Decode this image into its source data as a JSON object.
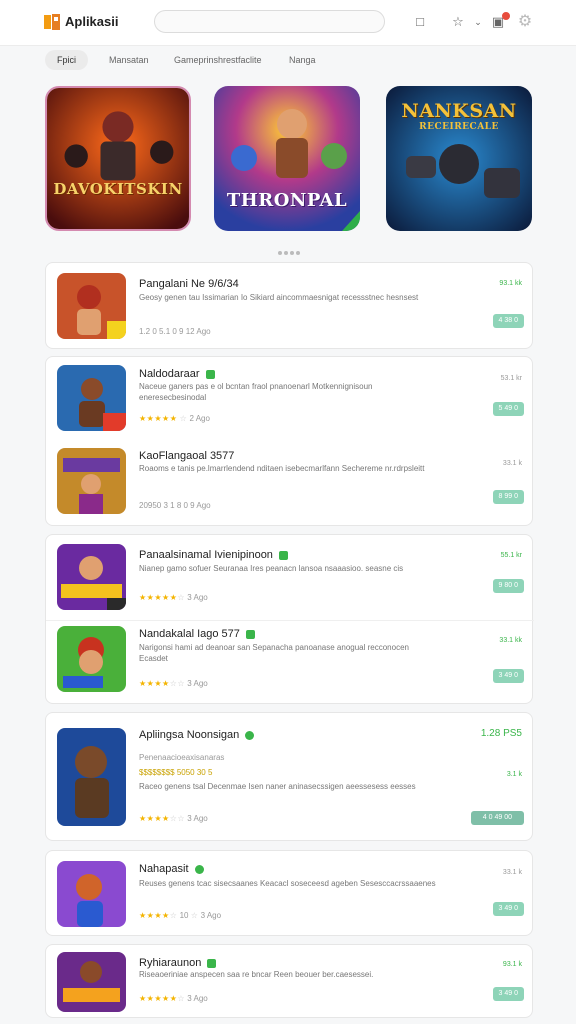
{
  "header": {
    "app_name": "Aplikasii",
    "search_placeholder": "",
    "icons": [
      "download-icon",
      "star-icon",
      "chevron-down-icon",
      "bag-icon",
      "settings-icon"
    ]
  },
  "tabs": [
    {
      "label": "Fpici",
      "active": true
    },
    {
      "label": "Mansatan",
      "active": false
    },
    {
      "label": "Gameprinshrestfaclite",
      "active": false
    },
    {
      "label": "Nanga",
      "active": false
    }
  ],
  "banners": [
    {
      "title": "DAVOKITSKIN"
    },
    {
      "title": "THRONPAL"
    },
    {
      "title": "NANKSAN",
      "subtitle": "RECEIRECALE"
    }
  ],
  "apps": [
    {
      "title": "Pangalani Ne 9/6/34",
      "desc": "Geosy genen tau Issimarian Io Sikiard aincommaesnigat recessstnec hesnsest",
      "meta": "1.2 0 5.1 0 9 12 Ago",
      "size": "93.1 kk",
      "download": "4 38 0"
    },
    {
      "title": "Naldodaraar",
      "desc": "Naceue ganers pas e ol bcntan fraol pnanoenarl Motkennignisoun eneresecbesinodal",
      "meta": "★★★★★ 2 Ago",
      "size": "53.1 kr",
      "download": "5 49 0"
    },
    {
      "title": "KaoFlangaoal 3577",
      "desc": "Roaoms e tanis pe.lmarrlendend nditaen isebecmarlfann Sechereme nr.rdrpsleitt",
      "meta": "20950 3 1 8 0 9 Ago",
      "size": "33.1 k",
      "download": "8 99 0"
    },
    {
      "title": "Panaalsinamal Ivienipinoon",
      "desc": "Nianep gamo sofuer Seuranaa Ires peanacn lansoa nsaaasioo. seasne cis",
      "meta": "★★★★★ 3 Ago",
      "size": "55.1 kr",
      "download": "9 80 0"
    },
    {
      "title": "Nandakalal Iago 577",
      "desc": "Narigonsi hami ad deanoar san Sepanacha panoanase anogual recconocen Ecasdet",
      "meta": "★★★★★ 3 Ago",
      "size": "33.1 kk",
      "download": "3 49 0"
    },
    {
      "title": "Apliingsa Noonsigan",
      "desc": "Raceo genens tsal Decenmae Isen naner aninasecssigen aeessesess eesses",
      "sub": "Penenaacioeaxisanaras",
      "sub2": "$$$$$$$$ 5050 30 5",
      "meta": "★★★★★ 3 Ago",
      "size": "3.1 k",
      "size_top": "1.28 PS5",
      "download": "4 0 49 00"
    },
    {
      "title": "Nahapasit",
      "desc": "Reuses genens tcac sisecsaanes Keacacl soseceesd ageben Sesesccacrssaaenes",
      "meta": "★★★★★ 3 Ago",
      "size": "33.1 k",
      "download": "3 49 0"
    },
    {
      "title": "Ryhiaraunon",
      "desc": "Riseaoeriniae anspecen saa re bncar Reen beouer ber.caesessei.",
      "meta": "★★★★★ 3 Ago",
      "size": "93.1 k",
      "download": "3 49 0"
    }
  ]
}
